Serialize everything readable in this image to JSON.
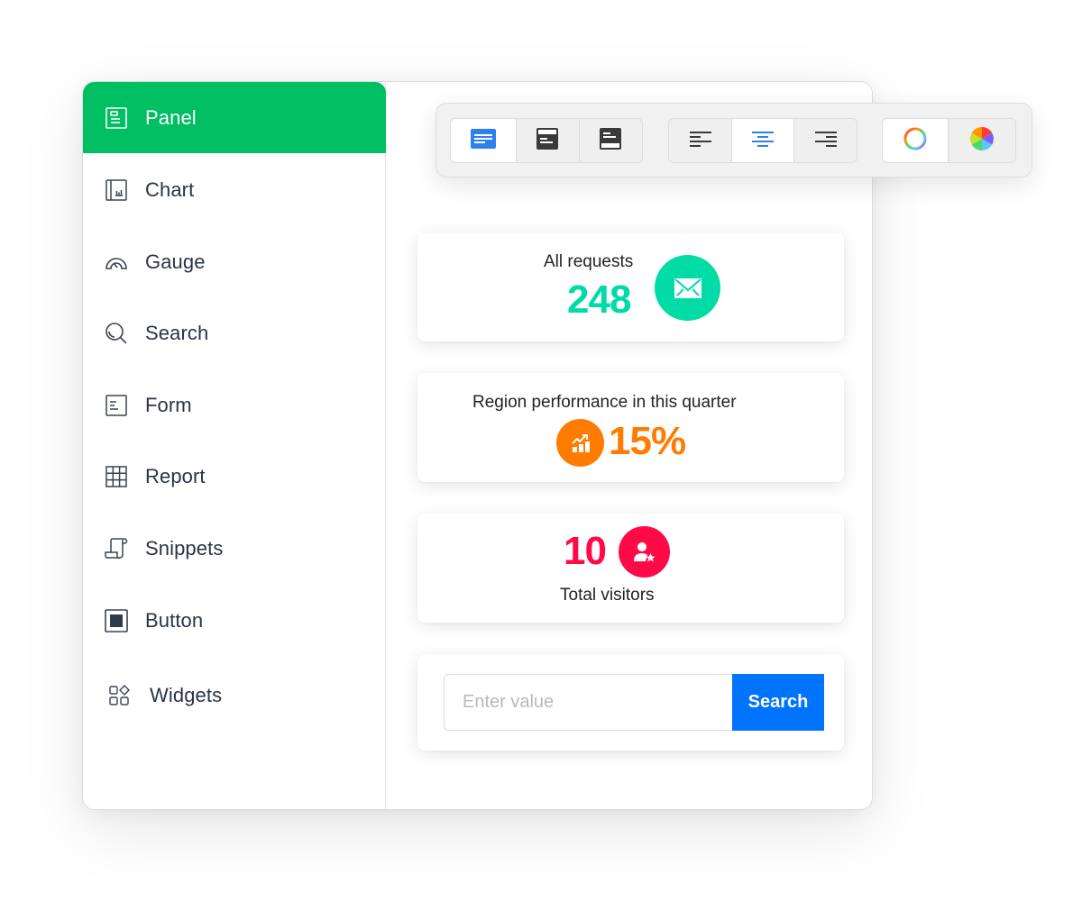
{
  "sidebar": {
    "items": [
      {
        "label": "Panel",
        "icon": "panel-icon",
        "active": true
      },
      {
        "label": "Chart",
        "icon": "chart-icon"
      },
      {
        "label": "Gauge",
        "icon": "gauge-icon"
      },
      {
        "label": "Search",
        "icon": "search-icon"
      },
      {
        "label": "Form",
        "icon": "form-icon"
      },
      {
        "label": "Report",
        "icon": "report-icon"
      },
      {
        "label": "Snippets",
        "icon": "snippets-icon"
      },
      {
        "label": "Button",
        "icon": "button-icon"
      },
      {
        "label": "Widgets",
        "icon": "widgets-icon"
      }
    ]
  },
  "toolbar": {
    "layout_buttons": [
      {
        "icon": "layout-plain-icon",
        "selected": true
      },
      {
        "icon": "layout-header-icon",
        "selected": false
      },
      {
        "icon": "layout-footer-icon",
        "selected": false
      }
    ],
    "align_buttons": [
      {
        "icon": "align-left-icon",
        "selected": false
      },
      {
        "icon": "align-center-icon",
        "selected": true
      },
      {
        "icon": "align-right-icon",
        "selected": false
      }
    ],
    "color_buttons": [
      {
        "icon": "color-ring-icon",
        "selected": true
      },
      {
        "icon": "color-wheel-icon",
        "selected": false
      }
    ]
  },
  "cards": {
    "requests": {
      "label": "All requests",
      "value": "248",
      "icon": "mail-icon",
      "color": "#00dba8"
    },
    "performance": {
      "label": "Region performance in this quarter",
      "value": "15%",
      "icon": "growth-chart-icon",
      "color": "#ff7c00"
    },
    "visitors": {
      "label": "Total visitors",
      "value": "10",
      "icon": "user-star-icon",
      "color": "#ff0a47"
    }
  },
  "search": {
    "placeholder": "Enter value",
    "value": "",
    "button_label": "Search"
  },
  "colors": {
    "accent": "#00bf63",
    "primary_button": "#0073ff",
    "selected_tool": "#2f80ed"
  }
}
